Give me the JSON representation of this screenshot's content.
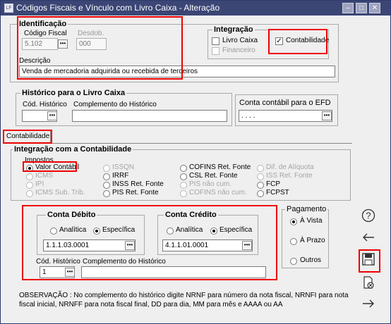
{
  "window": {
    "title": "Códigos Fiscais e Vínculo com Livro Caixa - Alteração",
    "app_icon_text": "LF"
  },
  "identificacao": {
    "legend": "Identificação",
    "codigo_fiscal_label": "Código Fiscal",
    "codigo_fiscal_value": "5.102",
    "desdob_label": "Desdob.",
    "desdob_value": "000",
    "descricao_label": "Descrição",
    "descricao_value": "Venda de mercadoria adquirida ou recebida de terceiros"
  },
  "integracao": {
    "legend": "Integração",
    "livro_caixa": "Livro Caixa",
    "financeiro": "Financeiro",
    "contabilidade": "Contabilidade",
    "contabilidade_checked": true
  },
  "historico": {
    "legend": "Histórico para o Livro Caixa",
    "cod_label": "Cód. Histórico",
    "complemento_label": "Complemento do Histórico",
    "cod_value": "",
    "complemento_value": ""
  },
  "efd": {
    "label": "Conta contábil para o EFD",
    "value": ". . . ."
  },
  "tabs": [
    {
      "label": "Contabilidade"
    }
  ],
  "integracao_contabilidade": {
    "legend": "Integração com a Contabilidade",
    "impostos_label": "Impostos",
    "options": {
      "valor_contabil": "Valor Contábil",
      "icms": "ICMS",
      "ipi": "IPI",
      "icms_sub_trib": "ICMS Sub. Trib.",
      "issqn": "ISSQN",
      "irrf": "IRRF",
      "inss_ret_fonte": "INSS Ret. Fonte",
      "pis_ret_fonte": "PIS Ret. Fonte",
      "cofins_ret_fonte": "COFINS Ret. Fonte",
      "csl_ret_fonte": "CSL Ret. Fonte",
      "pis_nao_cum": "PIS não cum.",
      "cofins_nao_cum": "COFINS não cum.",
      "dif_aliquota": "Dif. de Alíquota",
      "iss_ret_fonte": "ISS Ret. Fonte",
      "fcp": "FCP",
      "fcpst": "FCPST"
    },
    "selected": "Valor Contábil"
  },
  "conta_debito": {
    "legend": "Conta Débito",
    "analitica": "Analítica",
    "especifica": "Específica",
    "selected": "Específica",
    "value": "1.1.1.03.0001"
  },
  "conta_credito": {
    "legend": "Conta Crédito",
    "analitica": "Analítica",
    "especifica": "Específica",
    "selected": "Específica",
    "value": "4.1.1.01.0001"
  },
  "historico_contabil": {
    "cod_label": "Cód. Histórico",
    "cod_value": "1",
    "complemento_label": "Complemento do Histórico",
    "complemento_value": ""
  },
  "pagamento": {
    "legend": "Pagamento",
    "a_vista": "À Vista",
    "a_prazo": "À Prazo",
    "outros": "Outros",
    "selected": "À Vista"
  },
  "observacao": "OBSERVAÇÃO : No complemento do histórico digite NRNF para número da nota fiscal, NRNFI para nota fiscal inicial, NRNFF para nota fiscal final, DD para dia, MM para mês e AAAA ou AA",
  "icons": {
    "help": "question-circle-icon",
    "back": "arrow-left-icon",
    "save": "floppy-disk-icon",
    "cancel": "document-cancel-icon",
    "next": "arrow-right-icon"
  },
  "colors": {
    "titlebar": "#3b4675",
    "highlight": "#ee0000",
    "background": "#efefef"
  }
}
